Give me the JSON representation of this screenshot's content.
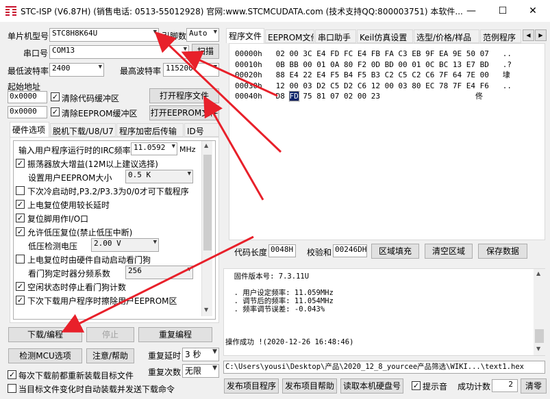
{
  "window": {
    "title": "STC-ISP (V6.87H) (销售电话: 0513-55012928) 官网:www.STCMCUDATA.com (技术支持QQ:800003751) 本软件..."
  },
  "left": {
    "mcu_label": "单片机型号",
    "mcu_value": "STC8H8K64U",
    "pin_label": "引脚数",
    "pin_value": "Auto",
    "port_label": "串口号",
    "port_value": "COM13",
    "scan_btn": "扫描",
    "min_baud_label": "最低波特率",
    "min_baud": "2400",
    "max_baud_label": "最高波特率",
    "max_baud": "115200",
    "start_addr_label": "起始地址",
    "addr1": "0x0000",
    "clear_code_label": "清除代码缓冲区",
    "open_prog_btn": "打开程序文件",
    "addr2": "0x0000",
    "clear_eeprom_label": "清除EEPROM缓冲区",
    "open_eeprom_btn": "打开EEPROM文件",
    "tabs": [
      "硬件选项",
      "脱机下载/U8/U7",
      "程序加密后传输",
      "ID号"
    ],
    "hw": {
      "irc_label": "输入用户程序运行时的IRC频率",
      "irc_value": "11.0592",
      "irc_unit": "MHz",
      "amp_label": "振荡器放大增益(12M以上建议选择)",
      "eeprom_size_label": "设置用户EEPROM大小",
      "eeprom_size": "0.5 K",
      "p32_label": "下次冷启动时,P3.2/P3.3为0/0才可下载程序",
      "reset_delay_label": "上电复位使用较长延时",
      "reset_io_label": "复位脚用作I/O口",
      "lvr_label": "允许低压复位(禁止低压中断)",
      "lvd_label": "低压检测电压",
      "lvd_value": "2.00 V",
      "wdt_label": "上电复位时由硬件自动启动看门狗",
      "wdt_div_label": "看门狗定时器分频系数",
      "wdt_div": "256",
      "idle_wdt_label": "空闲状态时停止看门狗计数",
      "erase_label": "下次下载用户程序时擦除用户EEPROM区"
    },
    "download_btn": "下载/编程",
    "stop_btn": "停止",
    "reprogram_btn": "重复编程",
    "check_btn": "检测MCU选项",
    "help_btn": "注意/帮助",
    "retry_delay_label": "重复延时",
    "retry_delay": "3 秒",
    "retry_count_label": "重复次数",
    "retry_count": "无限",
    "reload_label": "每次下载前都重新装载目标文件",
    "autoload_label": "当目标文件变化时自动装载并发送下载命令"
  },
  "right": {
    "tabs": [
      "程序文件",
      "EEPROM文件",
      "串口助手",
      "Keil仿真设置",
      "选型/价格/样品",
      "范例程序"
    ],
    "hex_rows": [
      {
        "addr": "00000h",
        "bytes": "02 00 3C E4 FD FC E4 FB FA C3 EB 9F EA 9E 50 07",
        "ascii": ".."
      },
      {
        "addr": "00010h",
        "bytes": "0B BB 00 01 0A 80 F2 0D BD 00 01 0C BC 13 E7 BD",
        "ascii": ".?"
      },
      {
        "addr": "00020h",
        "bytes": "88 E4 22 E4 F5 B4 F5 B3 C2 C5 C2 C6 7F 64 7E 00",
        "ascii": "埭"
      },
      {
        "addr": "00030h",
        "bytes": "12 00 03 D2 C5 D2 C6 12 00 03 80 EC 78 7F E4 F6",
        "ascii": ".."
      },
      {
        "addr": "00040h",
        "bytes_pre": "D8 ",
        "bytes_sel": "FD",
        "bytes_post": " 75 81 07 02 00 23",
        "ascii": "佟"
      }
    ],
    "code_len_label": "代码长度",
    "code_len": "0048H",
    "checksum_label": "校验和",
    "checksum": "00246DH",
    "fill_btn": "区域填充",
    "clear_btn": "清空区域",
    "save_btn": "保存数据",
    "log": "  固件版本号: 7.3.11U\n\n  . 用户设定频率: 11.059MHz\n  . 调节后的频率: 11.054MHz\n  . 频率调节误差: -0.043%\n\n\n\n操作成功 !(2020-12-26 16:48:46)",
    "path": "C:\\Users\\yousi\\Desktop\\产品\\2020_12_8_yourcee产品筛选\\WIKI...\\text1.hex",
    "publish_btn": "发布项目程序",
    "publish_help_btn": "发布项目帮助",
    "read_disk_btn": "读取本机硬盘号",
    "beep_label": "提示音",
    "count_label": "成功计数",
    "count": "2",
    "clear_count_btn": "清零"
  }
}
